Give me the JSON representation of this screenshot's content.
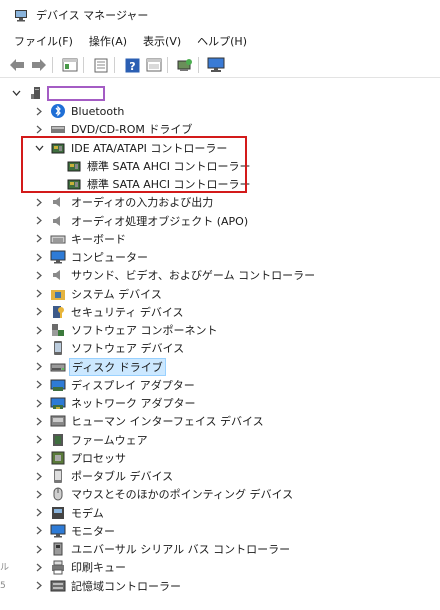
{
  "window": {
    "title": "デバイス マネージャー"
  },
  "menu": [
    "ファイル(F)",
    "操作(A)",
    "表示(V)",
    "ヘルプ(H)"
  ],
  "toolbar": [
    "back-arrow-icon",
    "forward-arrow-icon",
    "properties-icon",
    "update-icon",
    "help-icon",
    "view-icon",
    "scan-icon",
    "monitor-icon"
  ],
  "tree": {
    "root_label": "",
    "items": [
      {
        "label": "Bluetooth",
        "icon": "bluetooth-icon",
        "expanded": false
      },
      {
        "label": "DVD/CD-ROM ドライブ",
        "icon": "disc-drive-icon",
        "expanded": false
      },
      {
        "label": "IDE ATA/ATAPI コントローラー",
        "icon": "controller-icon",
        "expanded": true,
        "children": [
          {
            "label": "標準 SATA AHCI コントローラー",
            "icon": "controller-icon"
          },
          {
            "label": "標準 SATA AHCI コントローラー",
            "icon": "controller-icon"
          }
        ]
      },
      {
        "label": "オーディオの入力および出力",
        "icon": "speaker-icon",
        "expanded": false
      },
      {
        "label": "オーディオ処理オブジェクト (APO)",
        "icon": "speaker-icon",
        "expanded": false
      },
      {
        "label": "キーボード",
        "icon": "keyboard-icon",
        "expanded": false
      },
      {
        "label": "コンピューター",
        "icon": "computer-icon",
        "expanded": false
      },
      {
        "label": "サウンド、ビデオ、およびゲーム コントローラー",
        "icon": "speaker-icon",
        "expanded": false
      },
      {
        "label": "システム デバイス",
        "icon": "folder-chip-icon",
        "expanded": false
      },
      {
        "label": "セキュリティ デバイス",
        "icon": "key-icon",
        "expanded": false
      },
      {
        "label": "ソフトウェア コンポーネント",
        "icon": "puzzle-icon",
        "expanded": false
      },
      {
        "label": "ソフトウェア デバイス",
        "icon": "phone-icon",
        "expanded": false
      },
      {
        "label": "ディスク ドライブ",
        "icon": "hard-drive-icon",
        "expanded": false,
        "selected": true
      },
      {
        "label": "ディスプレイ アダプター",
        "icon": "display-adapter-icon",
        "expanded": false
      },
      {
        "label": "ネットワーク アダプター",
        "icon": "network-icon",
        "expanded": false
      },
      {
        "label": "ヒューマン インターフェイス デバイス",
        "icon": "hid-icon",
        "expanded": false
      },
      {
        "label": "ファームウェア",
        "icon": "firmware-icon",
        "expanded": false
      },
      {
        "label": "プロセッサ",
        "icon": "cpu-icon",
        "expanded": false
      },
      {
        "label": "ポータブル デバイス",
        "icon": "portable-icon",
        "expanded": false
      },
      {
        "label": "マウスとそのほかのポインティング デバイス",
        "icon": "mouse-icon",
        "expanded": false
      },
      {
        "label": "モデム",
        "icon": "modem-icon",
        "expanded": false
      },
      {
        "label": "モニター",
        "icon": "monitor-icon",
        "expanded": false
      },
      {
        "label": "ユニバーサル シリアル バス コントローラー",
        "icon": "usb-icon",
        "expanded": false
      },
      {
        "label": "印刷キュー",
        "icon": "printer-icon",
        "expanded": false
      },
      {
        "label": "記憶域コントローラー",
        "icon": "storage-icon",
        "expanded": false
      }
    ]
  },
  "colors": {
    "selection_bg": "#cce8ff",
    "highlight_box": "#d31a1a",
    "redaction_box": "#a45cc4"
  },
  "edge_marks": [
    "ル",
    "5"
  ]
}
